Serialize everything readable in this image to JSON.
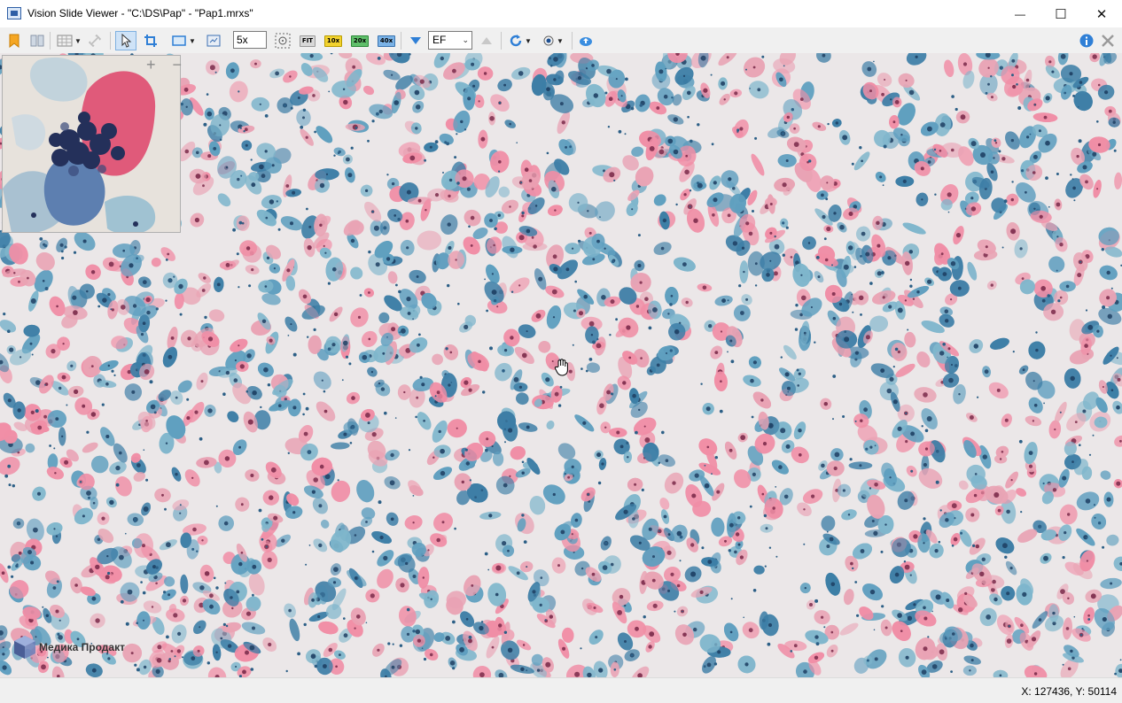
{
  "window": {
    "title": "Vision Slide Viewer - \"C:\\DS\\Pap\" - \"Pap1.mrxs\"",
    "minimize_glyph": "—",
    "maximize_glyph": "☐",
    "close_glyph": "✕"
  },
  "toolbar": {
    "zoom_value": "5x",
    "fit_label": "FIT",
    "mag_10": "10x",
    "mag_20": "20x",
    "mag_40": "40x",
    "focus_select_value": "EF",
    "icons": [
      "bookmark-icon",
      "split-view-icon",
      "grid-icon",
      "link-icon",
      "pointer-icon",
      "crop-icon",
      "region-icon",
      "screenshot-icon",
      "center-target-icon",
      "focus-down-icon",
      "focus-up-icon",
      "rotate-icon",
      "filter-icon",
      "upload-icon",
      "info-icon",
      "tools-icon"
    ],
    "colors": {
      "fit_bg": "#d8d8d8",
      "mag_10_bg": "#f2d22e",
      "mag_20_bg": "#5fbf6a",
      "mag_40_bg": "#7ab2e6",
      "accent_blue": "#2f7fd6"
    }
  },
  "overview": {
    "zoom_in_glyph": "+",
    "zoom_out_glyph": "−"
  },
  "watermark": {
    "text": "Медика Продакт"
  },
  "status": {
    "coordinates": "X: 127436, Y: 50114"
  },
  "slide": {
    "stain_colors": [
      "#e9a3b4",
      "#f08ea6",
      "#7fb6cc",
      "#5f9fbf",
      "#3d7ea6",
      "#2c5f86"
    ]
  }
}
